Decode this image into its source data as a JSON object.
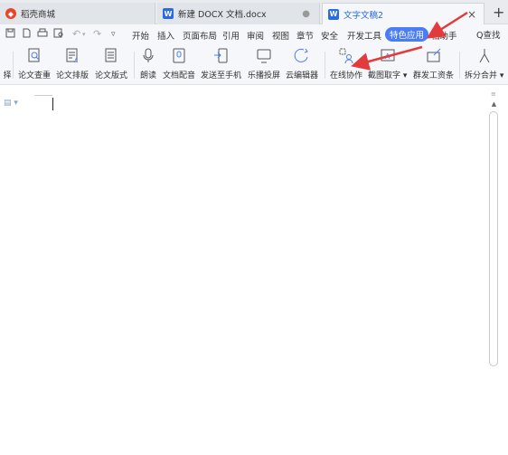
{
  "tabs": [
    {
      "label": "稻壳商城",
      "icon": "docer-icon",
      "color": "#e8462b"
    },
    {
      "label": "新建 DOCX 文档.docx",
      "icon": "word-doc-icon",
      "color": "#2b6be0"
    },
    {
      "label": "文字文稿2",
      "icon": "word-doc-icon",
      "color": "#2b6be0"
    }
  ],
  "new_tab_label": "+",
  "close_glyph": "×",
  "modified_glyph": "●",
  "menus": [
    "开始",
    "插入",
    "页面布局",
    "引用",
    "审阅",
    "视图",
    "章节",
    "安全",
    "开发工具",
    "特色应用",
    "档助手"
  ],
  "active_menu": "特色应用",
  "search_label": "Q查找",
  "ribbon": [
    {
      "label": "择",
      "icon": "partial-icon"
    },
    {
      "label": "论文查重",
      "icon": "paper-check-icon"
    },
    {
      "label": "论文排版",
      "icon": "paper-layout-icon"
    },
    {
      "label": "论文版式",
      "icon": "paper-format-icon"
    },
    {
      "label": "朗读",
      "icon": "read-aloud-icon"
    },
    {
      "label": "文档配音",
      "icon": "doc-dubbing-icon"
    },
    {
      "label": "发送至手机",
      "icon": "send-to-phone-icon"
    },
    {
      "label": "乐播投屏",
      "icon": "screen-cast-icon"
    },
    {
      "label": "云编辑器",
      "icon": "cloud-editor-icon"
    },
    {
      "label": "在线协作",
      "icon": "online-collab-icon"
    },
    {
      "label": "截图取字 ▾",
      "icon": "screenshot-ocr-icon"
    },
    {
      "label": "群发工资条",
      "icon": "payslip-icon"
    },
    {
      "label": "拆分合并 ▾",
      "icon": "split-merge-icon"
    }
  ],
  "accent_color": "#4b7cf3",
  "annotation_color": "#e23b3b"
}
